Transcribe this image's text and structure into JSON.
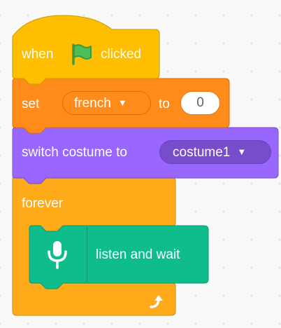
{
  "script": {
    "hat": {
      "prefix": "when",
      "suffix": "clicked",
      "icon": "green-flag-icon"
    },
    "set_variable": {
      "label": "set",
      "variable": "french",
      "connector": "to",
      "value": "0"
    },
    "switch_costume": {
      "label": "switch costume to",
      "costume": "costume1"
    },
    "forever": {
      "label": "forever",
      "loop_icon": "loop-arrow-icon"
    },
    "listen": {
      "label": "listen and wait",
      "icon": "microphone-icon"
    }
  },
  "colors": {
    "events": "#ffbf00",
    "variables": "#ff8c1a",
    "looks": "#9966ff",
    "control": "#ffab19",
    "speech": "#0fbd8c"
  }
}
